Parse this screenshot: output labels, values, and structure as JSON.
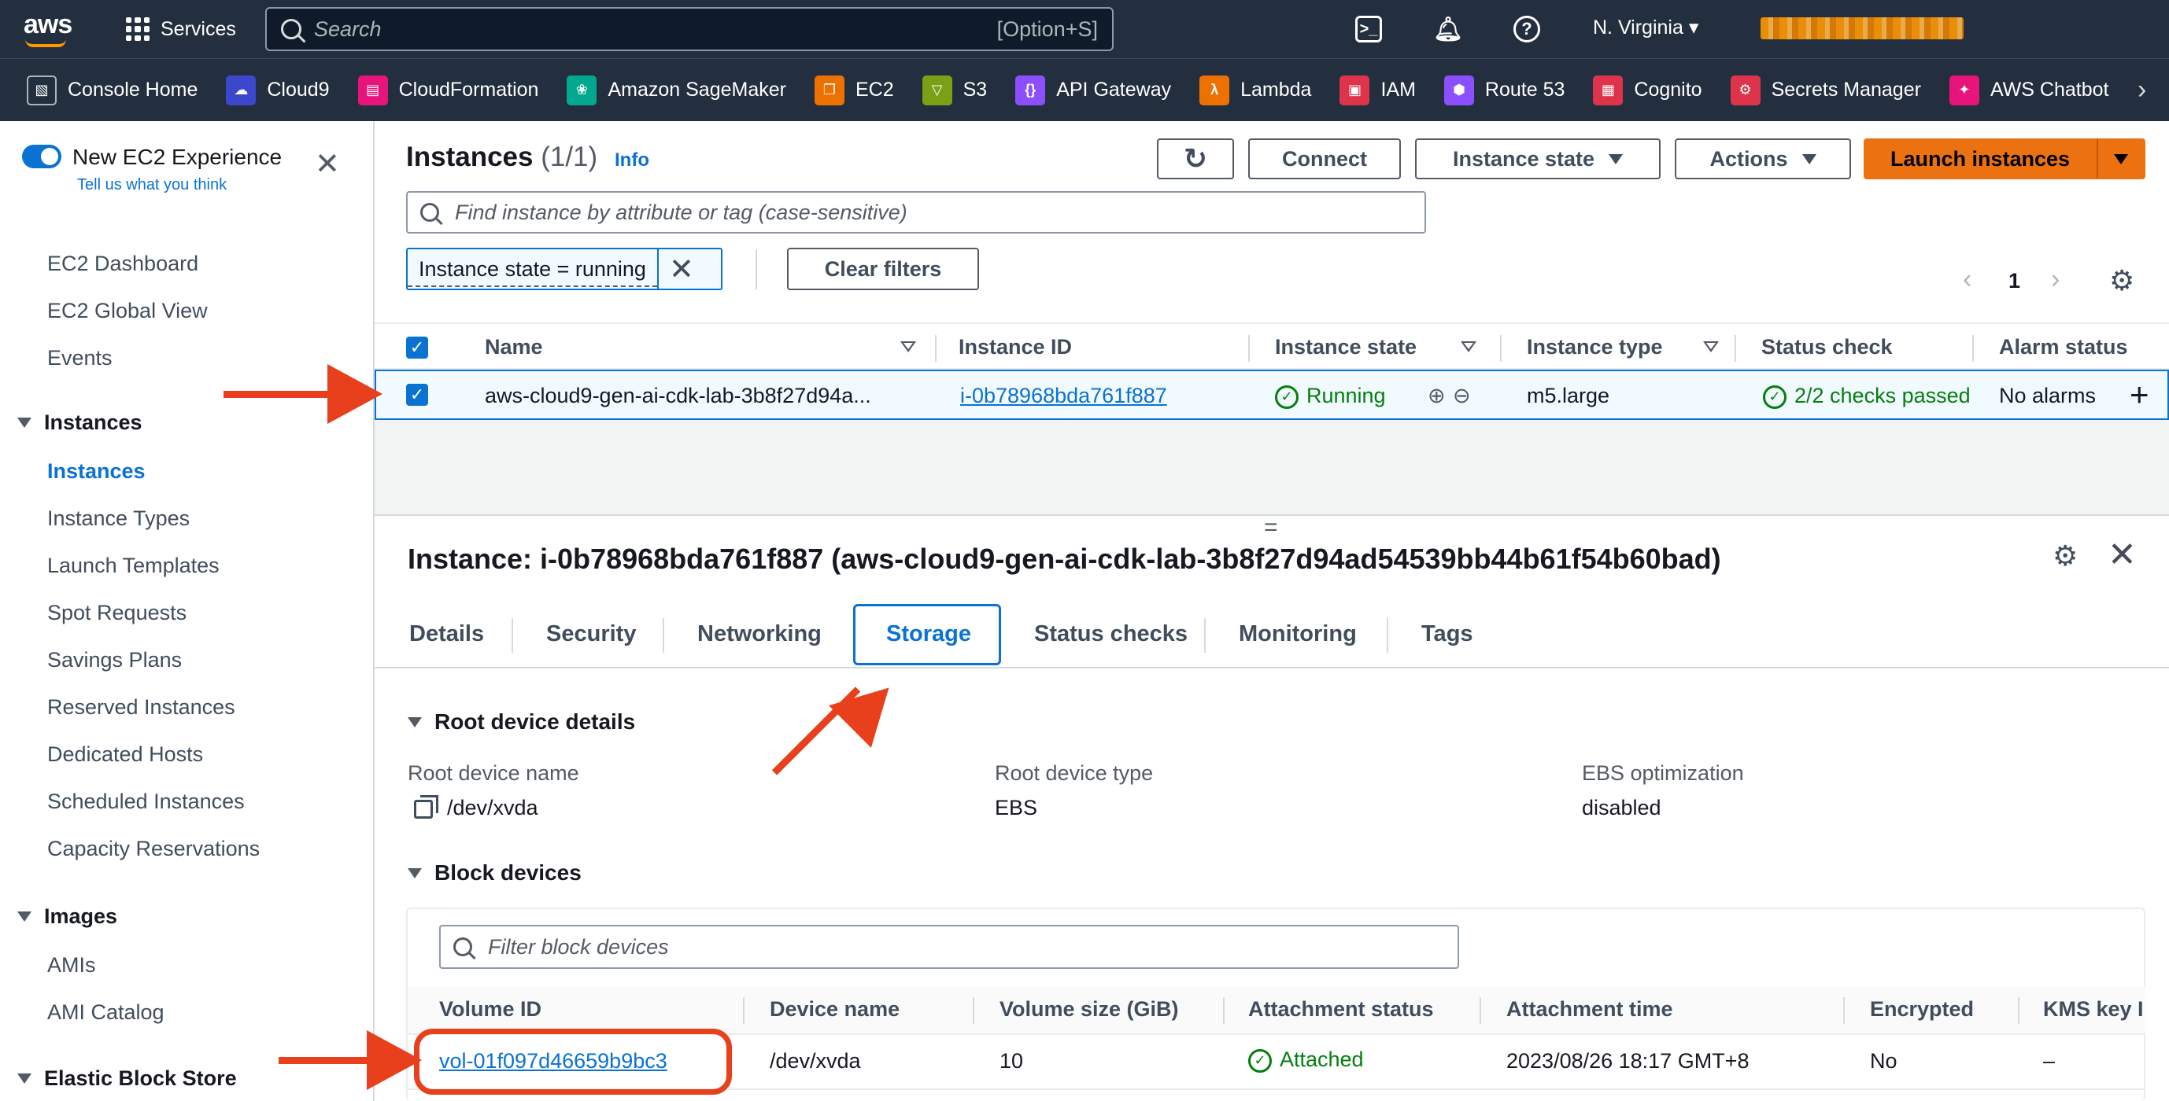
{
  "topnav": {
    "logo": "aws",
    "services_label": "Services",
    "search_placeholder": "Search",
    "search_shortcut": "[Option+S]",
    "region": "N. Virginia ▾",
    "icons": [
      "cloudshell-icon",
      "bell-icon",
      "help-icon"
    ]
  },
  "favorites": [
    {
      "label": "Console Home",
      "color": "#232f3e"
    },
    {
      "label": "Cloud9",
      "color": "#3b48cc"
    },
    {
      "label": "CloudFormation",
      "color": "#e7157b"
    },
    {
      "label": "Amazon SageMaker",
      "color": "#01a88d"
    },
    {
      "label": "EC2",
      "color": "#ed7100"
    },
    {
      "label": "S3",
      "color": "#7aa116"
    },
    {
      "label": "API Gateway",
      "color": "#8c4fff"
    },
    {
      "label": "Lambda",
      "color": "#ed7100"
    },
    {
      "label": "IAM",
      "color": "#dd344c"
    },
    {
      "label": "Route 53",
      "color": "#8c4fff"
    },
    {
      "label": "Cognito",
      "color": "#dd344c"
    },
    {
      "label": "Secrets Manager",
      "color": "#dd344c"
    },
    {
      "label": "AWS Chatbot",
      "color": "#e7157b"
    }
  ],
  "sidebar": {
    "toggle_label": "New EC2 Experience",
    "feedback_link": "Tell us what you think",
    "top_links": [
      "EC2 Dashboard",
      "EC2 Global View",
      "Events"
    ],
    "instances_section": "Instances",
    "instances_links": [
      "Instances",
      "Instance Types",
      "Launch Templates",
      "Spot Requests",
      "Savings Plans",
      "Reserved Instances",
      "Dedicated Hosts",
      "Scheduled Instances",
      "Capacity Reservations"
    ],
    "images_section": "Images",
    "images_links": [
      "AMIs",
      "AMI Catalog"
    ],
    "ebs_section": "Elastic Block Store"
  },
  "header": {
    "title": "Instances",
    "count": "(1/1)",
    "info": "Info",
    "refresh": "↻",
    "connect": "Connect",
    "instance_state": "Instance state",
    "actions": "Actions",
    "launch": "Launch instances",
    "find_placeholder": "Find instance by attribute or tag (case-sensitive)",
    "filter_token": "Instance state = running",
    "clear_filters": "Clear filters",
    "page": "1"
  },
  "table": {
    "columns": [
      "Name",
      "Instance ID",
      "Instance state",
      "Instance type",
      "Status check",
      "Alarm status"
    ],
    "row": {
      "name": "aws-cloud9-gen-ai-cdk-lab-3b8f27d94a...",
      "instance_id": "i-0b78968bda761f887",
      "state": "Running",
      "type": "m5.large",
      "status_check": "2/2 checks passed",
      "alarm": "No alarms",
      "add": "+"
    }
  },
  "detail": {
    "title": "Instance: i-0b78968bda761f887 (aws-cloud9-gen-ai-cdk-lab-3b8f27d94ad54539bb44b61f54b60bad)",
    "tabs": [
      "Details",
      "Security",
      "Networking",
      "Storage",
      "Status checks",
      "Monitoring",
      "Tags"
    ],
    "active_tab": "Storage",
    "root_section": "Root device details",
    "root_device_name_label": "Root device name",
    "root_device_name": "/dev/xvda",
    "root_device_type_label": "Root device type",
    "root_device_type": "EBS",
    "ebs_opt_label": "EBS optimization",
    "ebs_opt": "disabled",
    "block_section": "Block devices",
    "block_filter_placeholder": "Filter block devices",
    "block_columns": [
      "Volume ID",
      "Device name",
      "Volume size (GiB)",
      "Attachment status",
      "Attachment time",
      "Encrypted",
      "KMS key I"
    ],
    "block_row": {
      "volume_id": "vol-01f097d46659b9bc3",
      "device": "/dev/xvda",
      "size": "10",
      "status": "Attached",
      "time": "2023/08/26 18:17 GMT+8",
      "encrypted": "No",
      "kms": "–"
    }
  },
  "colors": {
    "nav_bg": "#232f3e",
    "accent_orange": "#ec7211",
    "link_blue": "#0972d3",
    "success_green": "#037f0c",
    "annotation_red": "#e8401c"
  }
}
